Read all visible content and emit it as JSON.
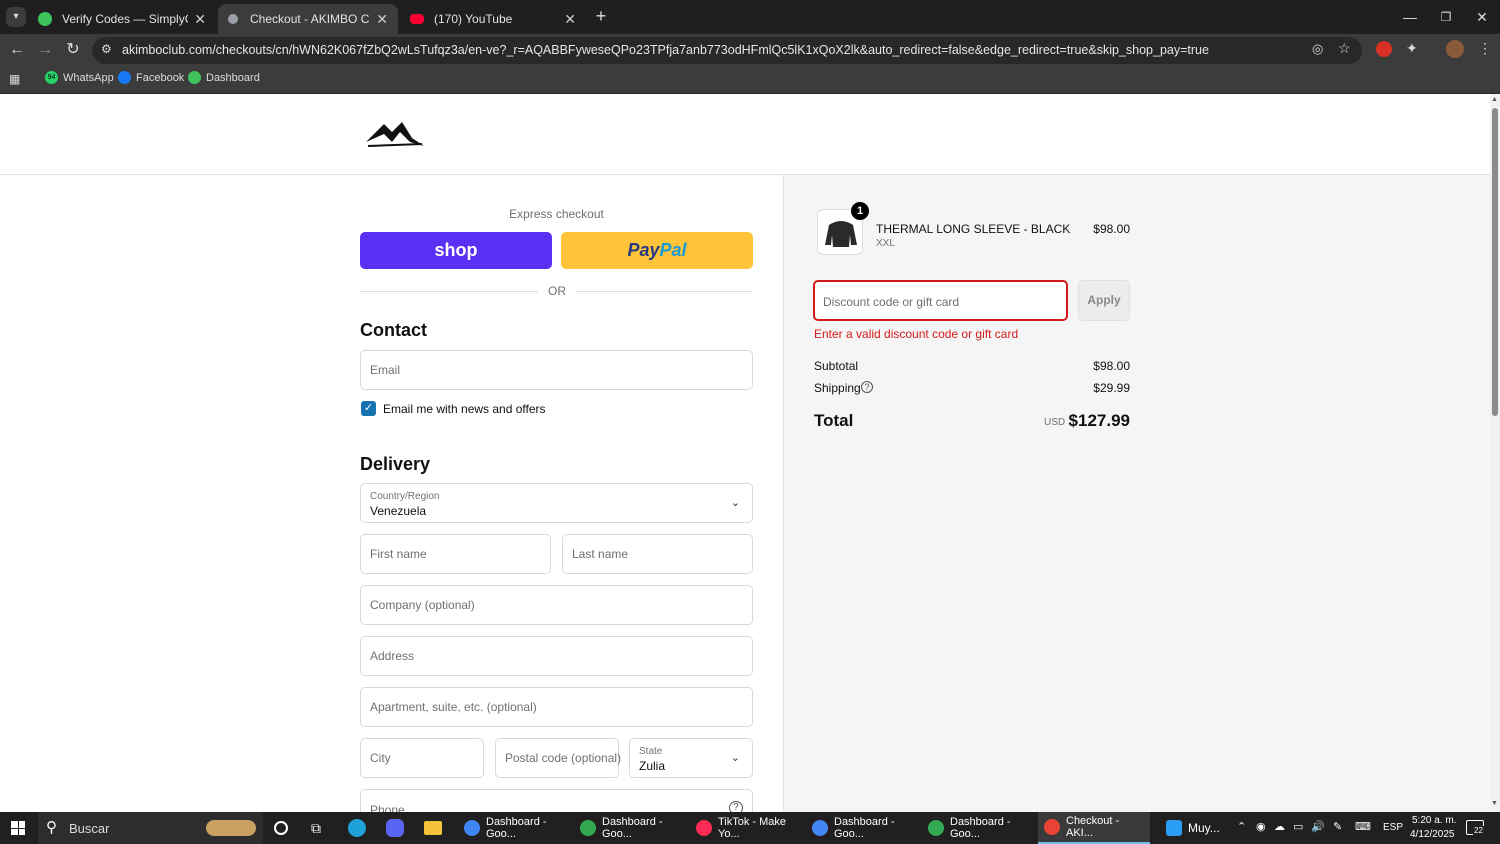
{
  "browser": {
    "tabs": [
      {
        "title": "Verify Codes — SimplyCodes",
        "icon": "simplycodes-icon",
        "color": "#3ec35a"
      },
      {
        "title": "Checkout - AKIMBO CLUB",
        "icon": "site-icon",
        "color": "#9aa0a6"
      },
      {
        "title": "(170) YouTube",
        "icon": "youtube-icon",
        "color": "#ff0033"
      }
    ],
    "new_tab": "+",
    "url": "akimboclub.com/checkouts/cn/hWN62K067fZbQ2wLsTufqz3a/en-ve?_r=AQABBFyweseQPo23TPfja7anb773odHFmlQc5lK1xQoX2lk&auto_redirect=false&edge_redirect=true&skip_shop_pay=true",
    "bookmarks": [
      {
        "label": "WhatsApp",
        "badge": "94",
        "color": "#25d366"
      },
      {
        "label": "Facebook",
        "color": "#1877f2"
      },
      {
        "label": "Dashboard",
        "color": "#3ec35a"
      }
    ]
  },
  "checkout": {
    "express_label": "Express checkout",
    "shop_pay_label": "shop",
    "paypal_pre": "Pay",
    "paypal_post": "Pal",
    "or_label": "OR",
    "contact": {
      "heading": "Contact",
      "email_placeholder": "Email",
      "newsletter_label": "Email me with news and offers",
      "newsletter_checked": true
    },
    "delivery": {
      "heading": "Delivery",
      "country_label": "Country/Region",
      "country_value": "Venezuela",
      "first_name_placeholder": "First name",
      "last_name_placeholder": "Last name",
      "company_placeholder": "Company (optional)",
      "address_placeholder": "Address",
      "apartment_placeholder": "Apartment, suite, etc. (optional)",
      "city_placeholder": "City",
      "postal_placeholder": "Postal code (optional)",
      "state_label": "State",
      "state_value": "Zulia",
      "phone_placeholder": "Phone"
    }
  },
  "summary": {
    "item": {
      "quantity": "1",
      "name": "THERMAL LONG SLEEVE - BLACK",
      "variant": "XXL",
      "price": "$98.00"
    },
    "discount_placeholder": "Discount code or gift card",
    "apply_label": "Apply",
    "discount_error": "Enter a valid discount code or gift card",
    "subtotal_label": "Subtotal",
    "subtotal_value": "$98.00",
    "shipping_label": "Shipping",
    "shipping_value": "$29.99",
    "total_label": "Total",
    "total_currency": "USD",
    "total_value": "$127.99",
    "error_color": "#d31a1a"
  },
  "taskbar": {
    "search_label": "Buscar",
    "apps": [
      {
        "label": "Dashboard - Goo...",
        "color": "#4285f4"
      },
      {
        "label": "Dashboard - Goo...",
        "color": "#34a853"
      },
      {
        "label": "TikTok - Make Yo...",
        "color": "#fe2c55"
      },
      {
        "label": "Dashboard - Goo...",
        "color": "#4285f4"
      },
      {
        "label": "Dashboard - Goo...",
        "color": "#34a853"
      },
      {
        "label": "Checkout - AKI...",
        "color": "#ea4335",
        "active": true
      }
    ],
    "weather_label": "Muy...",
    "language": "ESP",
    "time": "5:20 a. m.",
    "date": "4/12/2025",
    "notifications": "22"
  }
}
